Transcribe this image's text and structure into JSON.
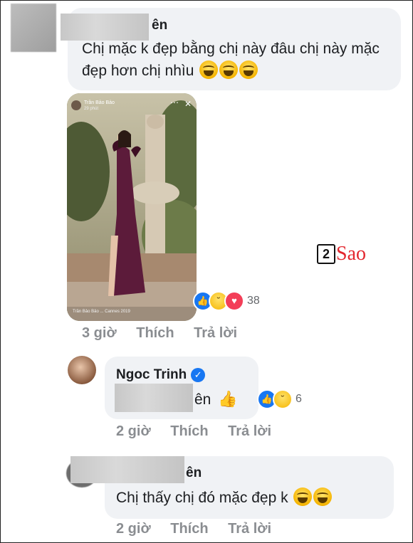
{
  "comment1": {
    "name_suffix": "ên",
    "text": "Chị mặc k đẹp bằng chị này đâu chị này mặc đẹp hơn chị nhìu",
    "emoji": [
      "laughing-tears",
      "laughing-tears",
      "laughing-tears"
    ],
    "image": {
      "poster": "Trần Bảo Bảo",
      "poster_time": "29 phút",
      "caption": "Trần Bảo Bảo ... Cannes 2019"
    },
    "reactions": {
      "icons": [
        "like-icon",
        "haha-icon",
        "love-icon"
      ],
      "count": "38"
    },
    "time": "3 giờ",
    "like_label": "Thích",
    "reply_label": "Trả lời"
  },
  "watermark": {
    "number": "2",
    "text": "Sao"
  },
  "reply1": {
    "name": "Ngoc Trinh",
    "verified": true,
    "text_suffix": "ên",
    "emoji": "thumbs-up",
    "reactions": {
      "icons": [
        "like-icon",
        "haha-icon"
      ],
      "count": "6"
    },
    "time": "2 giờ",
    "like_label": "Thích",
    "reply_label": "Trả lời"
  },
  "reply2": {
    "name_suffix": "ên",
    "text": "Chị thấy chị đó mặc đẹp k",
    "emoji": [
      "laughing-tears",
      "laughing-tears"
    ],
    "time": "2 giờ",
    "like_label": "Thích",
    "reply_label": "Trả lời"
  },
  "colors": {
    "bubble": "#f0f2f5",
    "meta": "#8a8d91",
    "like_blue": "#1877f2",
    "love_red": "#f33e58",
    "watermark_red": "#e3262e"
  }
}
